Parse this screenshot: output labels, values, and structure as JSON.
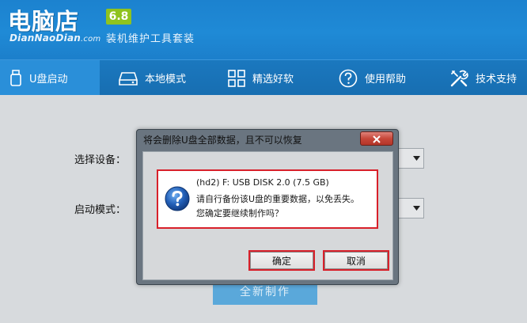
{
  "header": {
    "logo_main": "电脑店",
    "logo_sub": "DianNaoDian",
    "logo_domain": ".com",
    "version": "6.8",
    "subtitle": "装机维护工具套装"
  },
  "nav": {
    "items": [
      {
        "label": "U盘启动",
        "icon": "usb-drive-icon",
        "active": true
      },
      {
        "label": "本地模式",
        "icon": "hard-disk-icon",
        "active": false
      },
      {
        "label": "精选好软",
        "icon": "grid-apps-icon",
        "active": false
      },
      {
        "label": "使用帮助",
        "icon": "help-icon",
        "active": false
      },
      {
        "label": "技术支持",
        "icon": "tools-icon",
        "active": false
      }
    ]
  },
  "form": {
    "device_label": "选择设备：",
    "mode_label": "启动模式：",
    "start_button": "全新制作"
  },
  "dialog": {
    "title": "将会删除U盘全部数据，且不可以恢复",
    "message_lines": [
      "(hd2) F: USB DISK 2.0 (7.5 GB)",
      "请自行备份该U盘的重要数据，以免丢失。",
      "您确定要继续制作吗？"
    ],
    "confirm_label": "确定",
    "cancel_label": "取消"
  },
  "colors": {
    "header_blue": "#1f8ad6",
    "nav_blue": "#176eb1",
    "version_green": "#8fc31f",
    "highlight_red": "#d8202a"
  }
}
